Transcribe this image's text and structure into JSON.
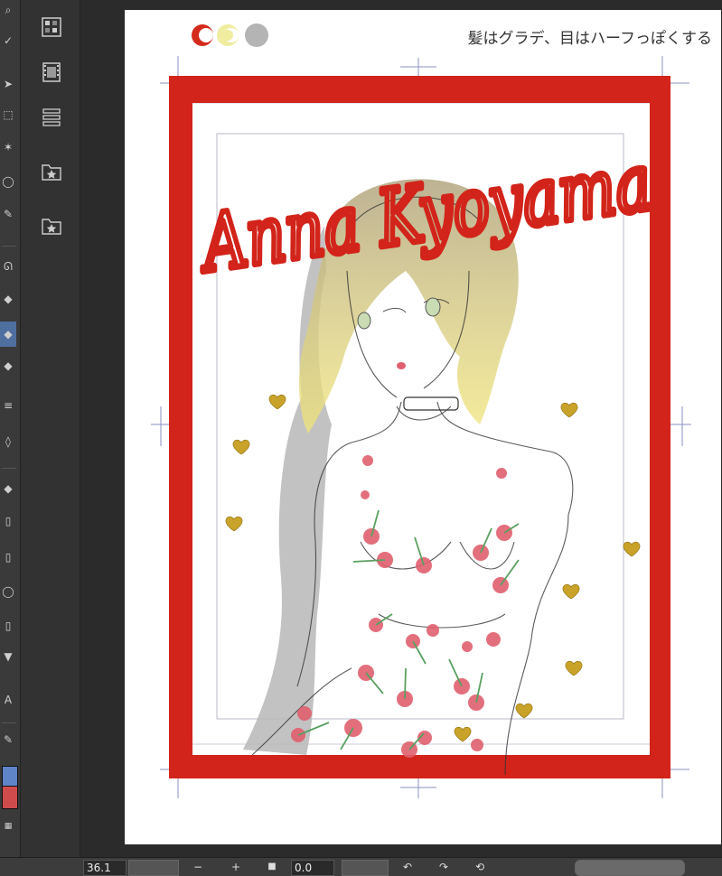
{
  "status_bar": {
    "zoom_value": "36.1",
    "rotation_value": "0.0",
    "zoom_out_label": "−",
    "zoom_in_label": "+",
    "stop_label": "■"
  },
  "canvas": {
    "color_dots": [
      "#d42a1c",
      "#f0eca0",
      "#b4b4b4"
    ],
    "handwritten_note": "髪はグラデ、目はハーフっぽくする",
    "title_script": "Anna Kyoyama"
  },
  "colors": {
    "frame_red": "#d2241a",
    "main_color": "#5f84c8",
    "sub_color": "#d04c4c",
    "hair_gradient_top": "#b2a580",
    "hair_gradient_bottom": "#f1e57a"
  },
  "icons": {
    "panel": [
      "grid-view-icon",
      "film-strip-icon",
      "layer-list-icon",
      "folder-star-icon",
      "folder-star-icon"
    ],
    "status": [
      "undo-icon",
      "redo-icon",
      "reset-rotation-icon"
    ]
  }
}
